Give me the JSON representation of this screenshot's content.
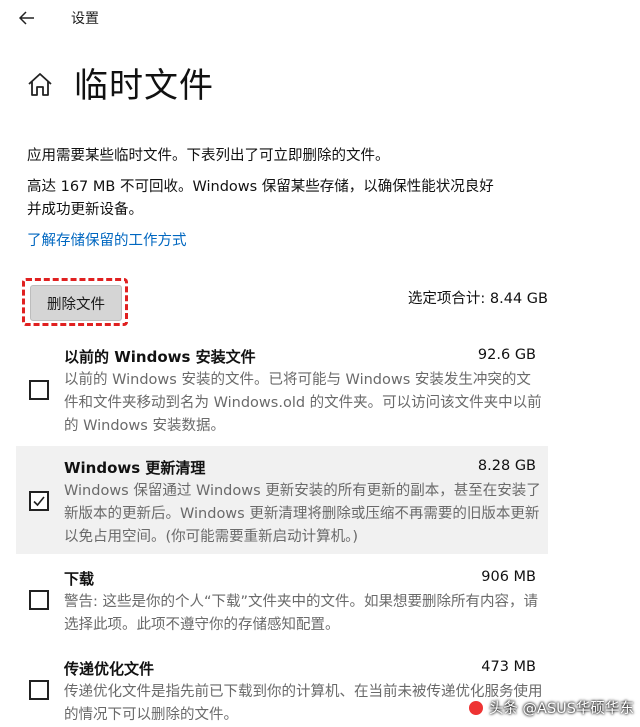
{
  "topbar": {
    "title": "设置"
  },
  "header": {
    "title": "临时文件"
  },
  "intro": "应用需要某些临时文件。下表列出了可立即删除的文件。",
  "reserve_line1": "高达 167 MB 不可回收。Windows 保留某些存储，以确保性能状况良好",
  "reserve_line2": "并成功更新设备。",
  "learn_link": "了解存储保留的工作方式",
  "delete_button": "删除文件",
  "total_selected": "选定项合计: 8.44 GB",
  "items": [
    {
      "name": "以前的 Windows 安装文件",
      "size": "92.6 GB",
      "checked": false,
      "desc": "以前的 Windows 安装的文件。已将可能与 Windows 安装发生冲突的文件和文件夹移动到名为 Windows.old 的文件夹。可以访问该文件夹中以前的 Windows 安装数据。"
    },
    {
      "name": "Windows 更新清理",
      "size": "8.28 GB",
      "checked": true,
      "desc": "Windows 保留通过 Windows 更新安装的所有更新的副本，甚至在安装了新版本的更新后。Windows 更新清理将删除或压缩不再需要的旧版本更新以免占用空间。(你可能需要重新启动计算机。)"
    },
    {
      "name": "下载",
      "size": "906 MB",
      "checked": false,
      "desc": "警告: 这些是你的个人“下载”文件夹中的文件。如果想要删除所有内容，请选择此项。此项不遵守你的存储感知配置。"
    },
    {
      "name": "传递优化文件",
      "size": "473 MB",
      "checked": false,
      "desc": "传递优化文件是指先前已下载到你的计算机、在当前未被传递优化服务使用的情况下可以删除的文件。"
    }
  ],
  "watermark": "头条 @ASUS华硕华东"
}
